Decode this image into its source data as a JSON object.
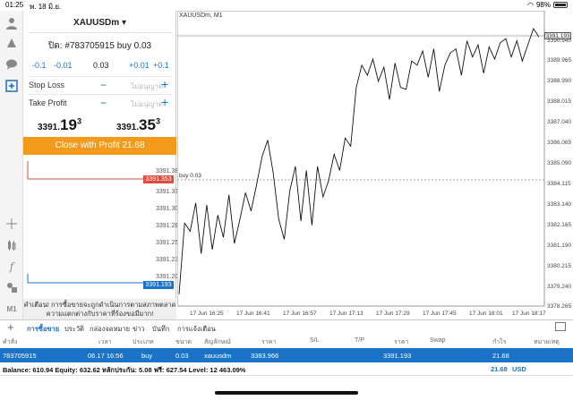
{
  "status": {
    "time": "01:25",
    "date": "พ. 18 มิ.ย.",
    "battery": "98%"
  },
  "toolbar": {
    "icons": [
      "user-icon",
      "accounts-icon",
      "chat-icon",
      "new-order-icon",
      "crosshair-icon",
      "chart-type-icon",
      "indicators-icon",
      "objects-icon",
      "timeframe-icon"
    ],
    "timeframe_label": "M1"
  },
  "panel": {
    "symbol": "XAUUSDm",
    "order_title": "ปิด: #783705915 buy 0.03",
    "steps": [
      "-0.1",
      "-0.01",
      "0.03",
      "+0.01",
      "+0.1"
    ],
    "stop_loss": {
      "label": "Stop Loss",
      "placeholder": "ไม่อนุญาต"
    },
    "take_profit": {
      "label": "Take Profit",
      "placeholder": "ไม่อนุญาต"
    },
    "bid": {
      "main": "3391.",
      "big": "19",
      "sup": "3"
    },
    "ask": {
      "main": "3391.",
      "big": "35",
      "sup": "3"
    },
    "close_button": "Close with Profit 21.68",
    "mini_levels": [
      "3391.380",
      "3391.353",
      "3391.330",
      "3391.305",
      "3391.280",
      "3391.255",
      "3391.230",
      "3391.205",
      "3391.193"
    ],
    "warning": "คำเตือน! การซื้อขายจะถูกดำเนินการตามสภาพตลาด ความแตกต่างกับราคาที่ร้องขอมีมาก!"
  },
  "chart": {
    "title": "XAUUSDm, M1",
    "buy_label": "buy 0.03",
    "current_price": "3391.193",
    "y_ticks": [
      "3391.193",
      "3390.940",
      "3389.965",
      "3388.990",
      "3388.015",
      "3387.040",
      "3386.065",
      "3385.090",
      "3384.115",
      "3383.140",
      "3382.165",
      "3381.190",
      "3380.215",
      "3379.240",
      "3378.265"
    ],
    "x_ticks": [
      "17 Jun 16:25",
      "17 Jun 16:41",
      "17 Jun 16:57",
      "17 Jun 17:13",
      "17 Jun 17:29",
      "17 Jun 17:45",
      "17 Jun 18:01",
      "17 Jun 18:17"
    ]
  },
  "chart_data": {
    "type": "line",
    "title": "XAUUSDm, M1",
    "ylim": [
      3378.0,
      3391.6
    ],
    "x": [
      "17 Jun 16:25",
      "17 Jun 16:41",
      "17 Jun 16:57",
      "17 Jun 17:13",
      "17 Jun 17:29",
      "17 Jun 17:45",
      "17 Jun 18:01",
      "17 Jun 18:17"
    ],
    "series": [
      {
        "values": [
          3378.5,
          3382.0,
          3381.6,
          3383.0,
          3380.5,
          3382.9,
          3380.7,
          3382.4,
          3381.3,
          3383.4,
          3381.0,
          3382.2,
          3383.5,
          3382.6,
          3383.9,
          3385.3,
          3386.1,
          3384.5,
          3382.2,
          3381.2,
          3383.6,
          3384.8,
          3382.1,
          3384.6,
          3381.9,
          3384.8,
          3383.3,
          3384.1,
          3385.4,
          3384.6,
          3386.2,
          3385.8,
          3388.7,
          3389.8,
          3389.3,
          3390.1,
          3389.0,
          3389.7,
          3388.1,
          3389.9,
          3388.7,
          3388.6,
          3390.0,
          3389.8,
          3390.5,
          3389.2,
          3390.6,
          3388.5,
          3389.8,
          3390.4,
          3390.6,
          3389.3,
          3391.0,
          3390.2,
          3390.8,
          3389.4,
          3390.7,
          3390.1,
          3390.9,
          3391.1,
          3390.2,
          3391.0,
          3390.0,
          3390.8,
          3391.6,
          3391.19
        ]
      }
    ]
  },
  "tabs": {
    "items": [
      "การซื้อขาย",
      "ประวัติ",
      "กล่องจดหมาย",
      "ข่าว",
      "บันทึก",
      "การแจ้งเตือน"
    ],
    "active": 0
  },
  "table": {
    "headers": [
      "คำสั่ง",
      "เวลา",
      "ประเภท",
      "ขนาด",
      "สัญลักษณ์",
      "ราคา",
      "S/L",
      "T/P",
      "ราคา",
      "Swap",
      "กำไร",
      "หมายเหตุ"
    ],
    "row": {
      "order": "783705915",
      "time": "06.17 16:56",
      "type": "buy",
      "size": "0.03",
      "symbol": "xauusdm",
      "open_price": "3383.966",
      "price": "3391.193",
      "profit": "21.68"
    }
  },
  "balance": {
    "text": "Balance: 610.94 Equity: 632.62 หลักประกัน: 5.08 ฟรี: 627.54 Level: 12 463.09%",
    "profit": "21.68",
    "currency": "USD"
  },
  "colors": {
    "accent": "#1a73c8",
    "close_button": "#f39a1a",
    "sell_marker": "#e04b3c"
  }
}
